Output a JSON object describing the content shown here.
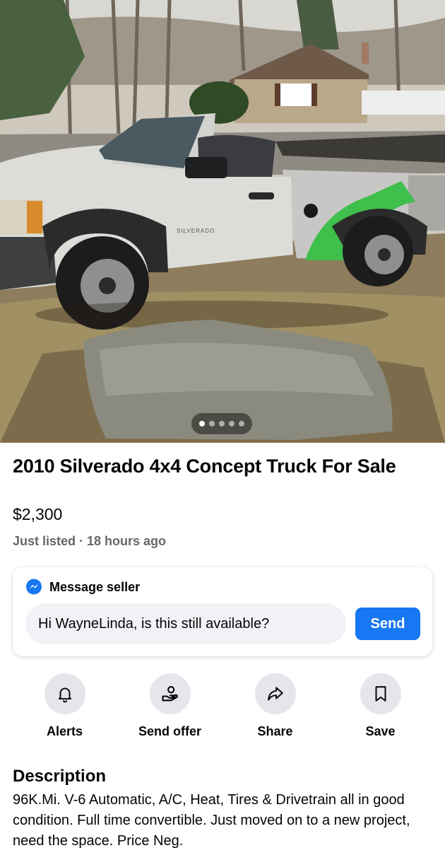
{
  "photo": {
    "alt": "Silver pickup truck with cut-off cab roof, green patched bed, parked on a lawn beside a large flat rock",
    "badge_text": "SILVERADO",
    "carousel": {
      "count": 5,
      "active_index": 0
    }
  },
  "listing": {
    "title": "2010 Silverado 4x4 Concept Truck For Sale",
    "price": "$2,300",
    "listed": "Just listed · 18 hours ago"
  },
  "message": {
    "header_label": "Message seller",
    "header_icon": "messenger-icon",
    "input_value": "Hi WayneLinda, is this still available?",
    "send_label": "Send"
  },
  "actions": [
    {
      "label": "Alerts",
      "icon": "bell-icon"
    },
    {
      "label": "Send offer",
      "icon": "offer-hand-icon"
    },
    {
      "label": "Share",
      "icon": "share-arrow-icon"
    },
    {
      "label": "Save",
      "icon": "bookmark-icon"
    }
  ],
  "description": {
    "heading": "Description",
    "body": "96K.Mi. V-6 Automatic, A/C, Heat, Tires & Drivetrain all in good condition. Full time convertible. Just moved on to a new project, need the space.  Price Neg."
  },
  "colors": {
    "accent": "#1877f2",
    "secondary_text": "#65676b",
    "action_circle": "#e4e6eb",
    "input_bg": "#f0f2f5"
  }
}
